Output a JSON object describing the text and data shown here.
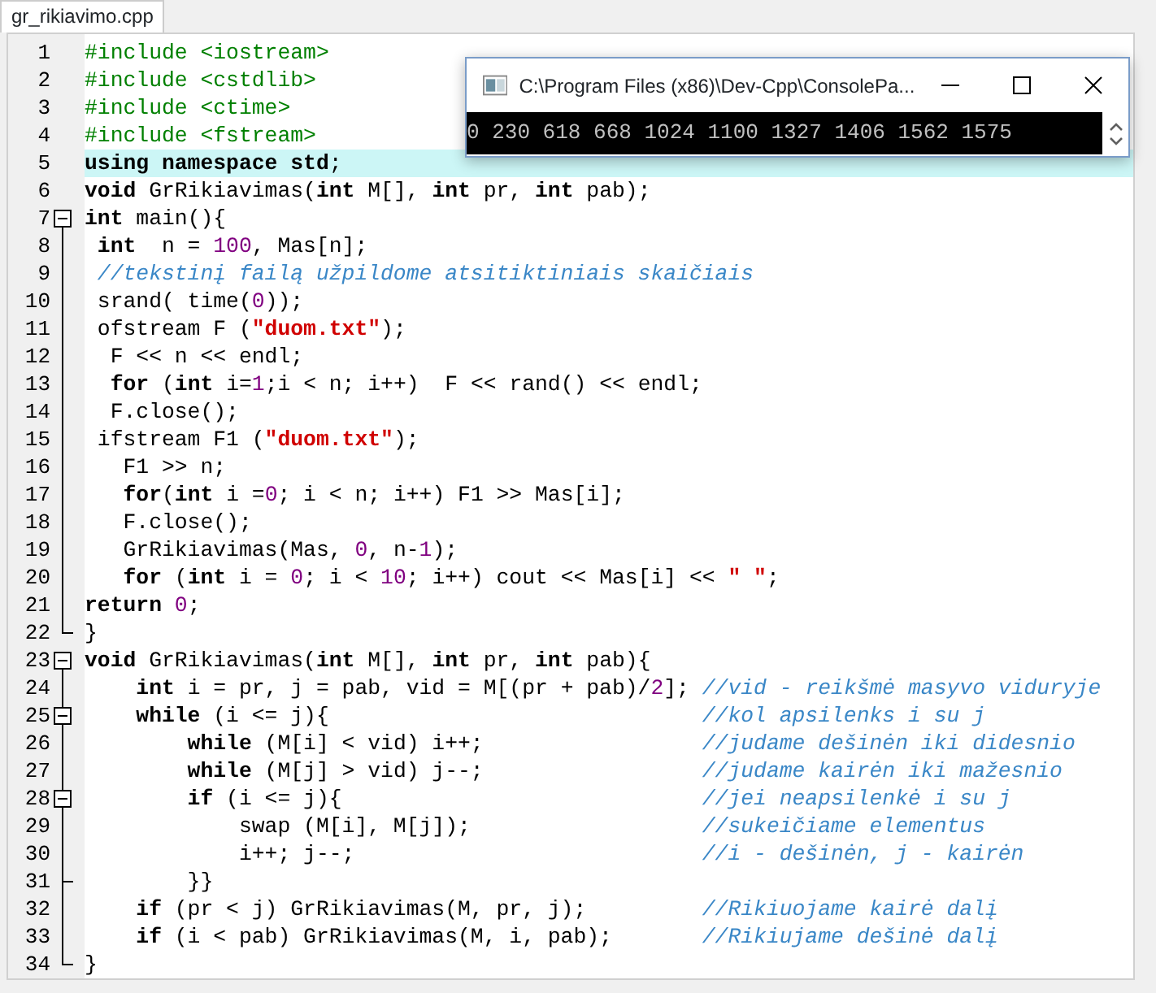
{
  "tab": {
    "label": "gr_rikiavimo.cpp",
    "selected": true
  },
  "lines": [
    {
      "number": "1",
      "segments": [
        {
          "kind": "pre",
          "text": "#include <iostream>"
        }
      ]
    },
    {
      "number": "2",
      "segments": [
        {
          "kind": "pre",
          "text": "#include <cstdlib>"
        }
      ]
    },
    {
      "number": "3",
      "segments": [
        {
          "kind": "pre",
          "text": "#include <ctime>"
        }
      ]
    },
    {
      "number": "4",
      "segments": [
        {
          "kind": "pre",
          "text": "#include <fstream>"
        }
      ]
    },
    {
      "number": "5",
      "selected": true,
      "segments": [
        {
          "kind": "kw",
          "text": "using namespace std"
        },
        {
          "kind": "plain",
          "text": ";"
        }
      ]
    },
    {
      "number": "6",
      "segments": [
        {
          "kind": "kw",
          "text": "void"
        },
        {
          "kind": "plain",
          "text": " GrRikiavimas("
        },
        {
          "kind": "kw",
          "text": "int"
        },
        {
          "kind": "plain",
          "text": " M[], "
        },
        {
          "kind": "kw",
          "text": "int"
        },
        {
          "kind": "plain",
          "text": " pr, "
        },
        {
          "kind": "kw",
          "text": "int"
        },
        {
          "kind": "plain",
          "text": " pab);"
        }
      ]
    },
    {
      "number": "7",
      "fold_start": true,
      "segments": [
        {
          "kind": "kw",
          "text": "int"
        },
        {
          "kind": "plain",
          "text": " main(){"
        }
      ]
    },
    {
      "number": "8",
      "segments": [
        {
          "kind": "kw",
          "text": " int"
        },
        {
          "kind": "plain",
          "text": "  n = "
        },
        {
          "kind": "num",
          "text": "100"
        },
        {
          "kind": "plain",
          "text": ", Mas[n];"
        }
      ]
    },
    {
      "number": "9",
      "segments": [
        {
          "kind": "cmt",
          "text": " //tekstinį failą užpildome atsitiktiniais skaičiais"
        }
      ]
    },
    {
      "number": "10",
      "segments": [
        {
          "kind": "plain",
          "text": " srand( time("
        },
        {
          "kind": "num",
          "text": "0"
        },
        {
          "kind": "plain",
          "text": "));"
        }
      ]
    },
    {
      "number": "11",
      "segments": [
        {
          "kind": "plain",
          "text": " ofstream F ("
        },
        {
          "kind": "str",
          "text": "\"duom.txt\""
        },
        {
          "kind": "plain",
          "text": ");"
        }
      ]
    },
    {
      "number": "12",
      "segments": [
        {
          "kind": "plain",
          "text": "  F << n << endl;"
        }
      ]
    },
    {
      "number": "13",
      "segments": [
        {
          "kind": "kw",
          "text": "  for"
        },
        {
          "kind": "plain",
          "text": " ("
        },
        {
          "kind": "kw",
          "text": "int"
        },
        {
          "kind": "plain",
          "text": " i="
        },
        {
          "kind": "num",
          "text": "1"
        },
        {
          "kind": "plain",
          "text": ";i < n; i++)  F << rand() << endl;"
        }
      ]
    },
    {
      "number": "14",
      "segments": [
        {
          "kind": "plain",
          "text": "  F.close();"
        }
      ]
    },
    {
      "number": "15",
      "segments": [
        {
          "kind": "plain",
          "text": " ifstream F1 ("
        },
        {
          "kind": "str",
          "text": "\"duom.txt\""
        },
        {
          "kind": "plain",
          "text": ");"
        }
      ]
    },
    {
      "number": "16",
      "segments": [
        {
          "kind": "plain",
          "text": "   F1 >> n;"
        }
      ]
    },
    {
      "number": "17",
      "segments": [
        {
          "kind": "kw",
          "text": "   for"
        },
        {
          "kind": "plain",
          "text": "("
        },
        {
          "kind": "kw",
          "text": "int"
        },
        {
          "kind": "plain",
          "text": " i ="
        },
        {
          "kind": "num",
          "text": "0"
        },
        {
          "kind": "plain",
          "text": "; i < n; i++) F1 >> Mas[i];"
        }
      ]
    },
    {
      "number": "18",
      "segments": [
        {
          "kind": "plain",
          "text": "   F.close();"
        }
      ]
    },
    {
      "number": "19",
      "segments": [
        {
          "kind": "plain",
          "text": "   GrRikiavimas(Mas, "
        },
        {
          "kind": "num",
          "text": "0"
        },
        {
          "kind": "plain",
          "text": ", n-"
        },
        {
          "kind": "num",
          "text": "1"
        },
        {
          "kind": "plain",
          "text": ");"
        }
      ]
    },
    {
      "number": "20",
      "segments": [
        {
          "kind": "kw",
          "text": "   for"
        },
        {
          "kind": "plain",
          "text": " ("
        },
        {
          "kind": "kw",
          "text": "int"
        },
        {
          "kind": "plain",
          "text": " i = "
        },
        {
          "kind": "num",
          "text": "0"
        },
        {
          "kind": "plain",
          "text": "; i < "
        },
        {
          "kind": "num",
          "text": "10"
        },
        {
          "kind": "plain",
          "text": "; i++) cout << Mas[i] << "
        },
        {
          "kind": "str",
          "text": "\" \""
        },
        {
          "kind": "plain",
          "text": ";"
        }
      ]
    },
    {
      "number": "21",
      "segments": [
        {
          "kind": "kw",
          "text": "return "
        },
        {
          "kind": "num",
          "text": "0"
        },
        {
          "kind": "plain",
          "text": ";"
        }
      ]
    },
    {
      "number": "22",
      "fold_end": true,
      "segments": [
        {
          "kind": "plain",
          "text": "}"
        }
      ]
    },
    {
      "number": "23",
      "fold_start": true,
      "segments": [
        {
          "kind": "kw",
          "text": "void"
        },
        {
          "kind": "plain",
          "text": " GrRikiavimas("
        },
        {
          "kind": "kw",
          "text": "int"
        },
        {
          "kind": "plain",
          "text": " M[], "
        },
        {
          "kind": "kw",
          "text": "int"
        },
        {
          "kind": "plain",
          "text": " pr, "
        },
        {
          "kind": "kw",
          "text": "int"
        },
        {
          "kind": "plain",
          "text": " pab){"
        }
      ]
    },
    {
      "number": "24",
      "segments": [
        {
          "kind": "kw",
          "text": "    int"
        },
        {
          "kind": "plain",
          "text": " i = pr, j = pab, vid = M[(pr + pab)/"
        },
        {
          "kind": "num",
          "text": "2"
        },
        {
          "kind": "plain",
          "text": "]; "
        },
        {
          "kind": "cmt",
          "text": "//vid - reikšmė masyvo viduryje"
        }
      ]
    },
    {
      "number": "25",
      "fold_start": true,
      "segments": [
        {
          "kind": "kw",
          "text": "    while"
        },
        {
          "kind": "plain",
          "text": " (i <= j){                             "
        },
        {
          "kind": "cmt",
          "text": "//kol apsilenks i su j"
        }
      ]
    },
    {
      "number": "26",
      "segments": [
        {
          "kind": "kw",
          "text": "        while"
        },
        {
          "kind": "plain",
          "text": " (M[i] < vid) i++;                 "
        },
        {
          "kind": "cmt",
          "text": "//judame dešinėn iki didesnio"
        }
      ]
    },
    {
      "number": "27",
      "segments": [
        {
          "kind": "kw",
          "text": "        while"
        },
        {
          "kind": "plain",
          "text": " (M[j] > vid) j--;                 "
        },
        {
          "kind": "cmt",
          "text": "//judame kairėn iki mažesnio"
        }
      ]
    },
    {
      "number": "28",
      "fold_start": true,
      "segments": [
        {
          "kind": "kw",
          "text": "        if"
        },
        {
          "kind": "plain",
          "text": " (i <= j){                            "
        },
        {
          "kind": "cmt",
          "text": "//jei neapsilenkė i su j"
        }
      ]
    },
    {
      "number": "29",
      "segments": [
        {
          "kind": "plain",
          "text": "            swap (M[i], M[j]);                  "
        },
        {
          "kind": "cmt",
          "text": "//sukeičiame elementus"
        }
      ]
    },
    {
      "number": "30",
      "segments": [
        {
          "kind": "plain",
          "text": "            i++; j--;                           "
        },
        {
          "kind": "cmt",
          "text": "//i - dešinėn, j - kairėn"
        }
      ]
    },
    {
      "number": "31",
      "fold_end": true,
      "segments": [
        {
          "kind": "plain",
          "text": "        }}"
        }
      ]
    },
    {
      "number": "32",
      "segments": [
        {
          "kind": "kw",
          "text": "    if"
        },
        {
          "kind": "plain",
          "text": " (pr < j) GrRikiavimas(M, pr, j);         "
        },
        {
          "kind": "cmt",
          "text": "//Rikiuojame kairė dalį"
        }
      ]
    },
    {
      "number": "33",
      "segments": [
        {
          "kind": "kw",
          "text": "    if"
        },
        {
          "kind": "plain",
          "text": " (i < pab) GrRikiavimas(M, i, pab);       "
        },
        {
          "kind": "cmt",
          "text": "//Rikiujame dešinė dalį"
        }
      ]
    },
    {
      "number": "34",
      "fold_end": true,
      "segments": [
        {
          "kind": "plain",
          "text": "}"
        }
      ]
    }
  ],
  "console": {
    "title": "C:\\Program Files (x86)\\Dev-Cpp\\ConsolePa...",
    "output": "0 230 618 668 1024 1100 1327 1406 1562 1575"
  }
}
